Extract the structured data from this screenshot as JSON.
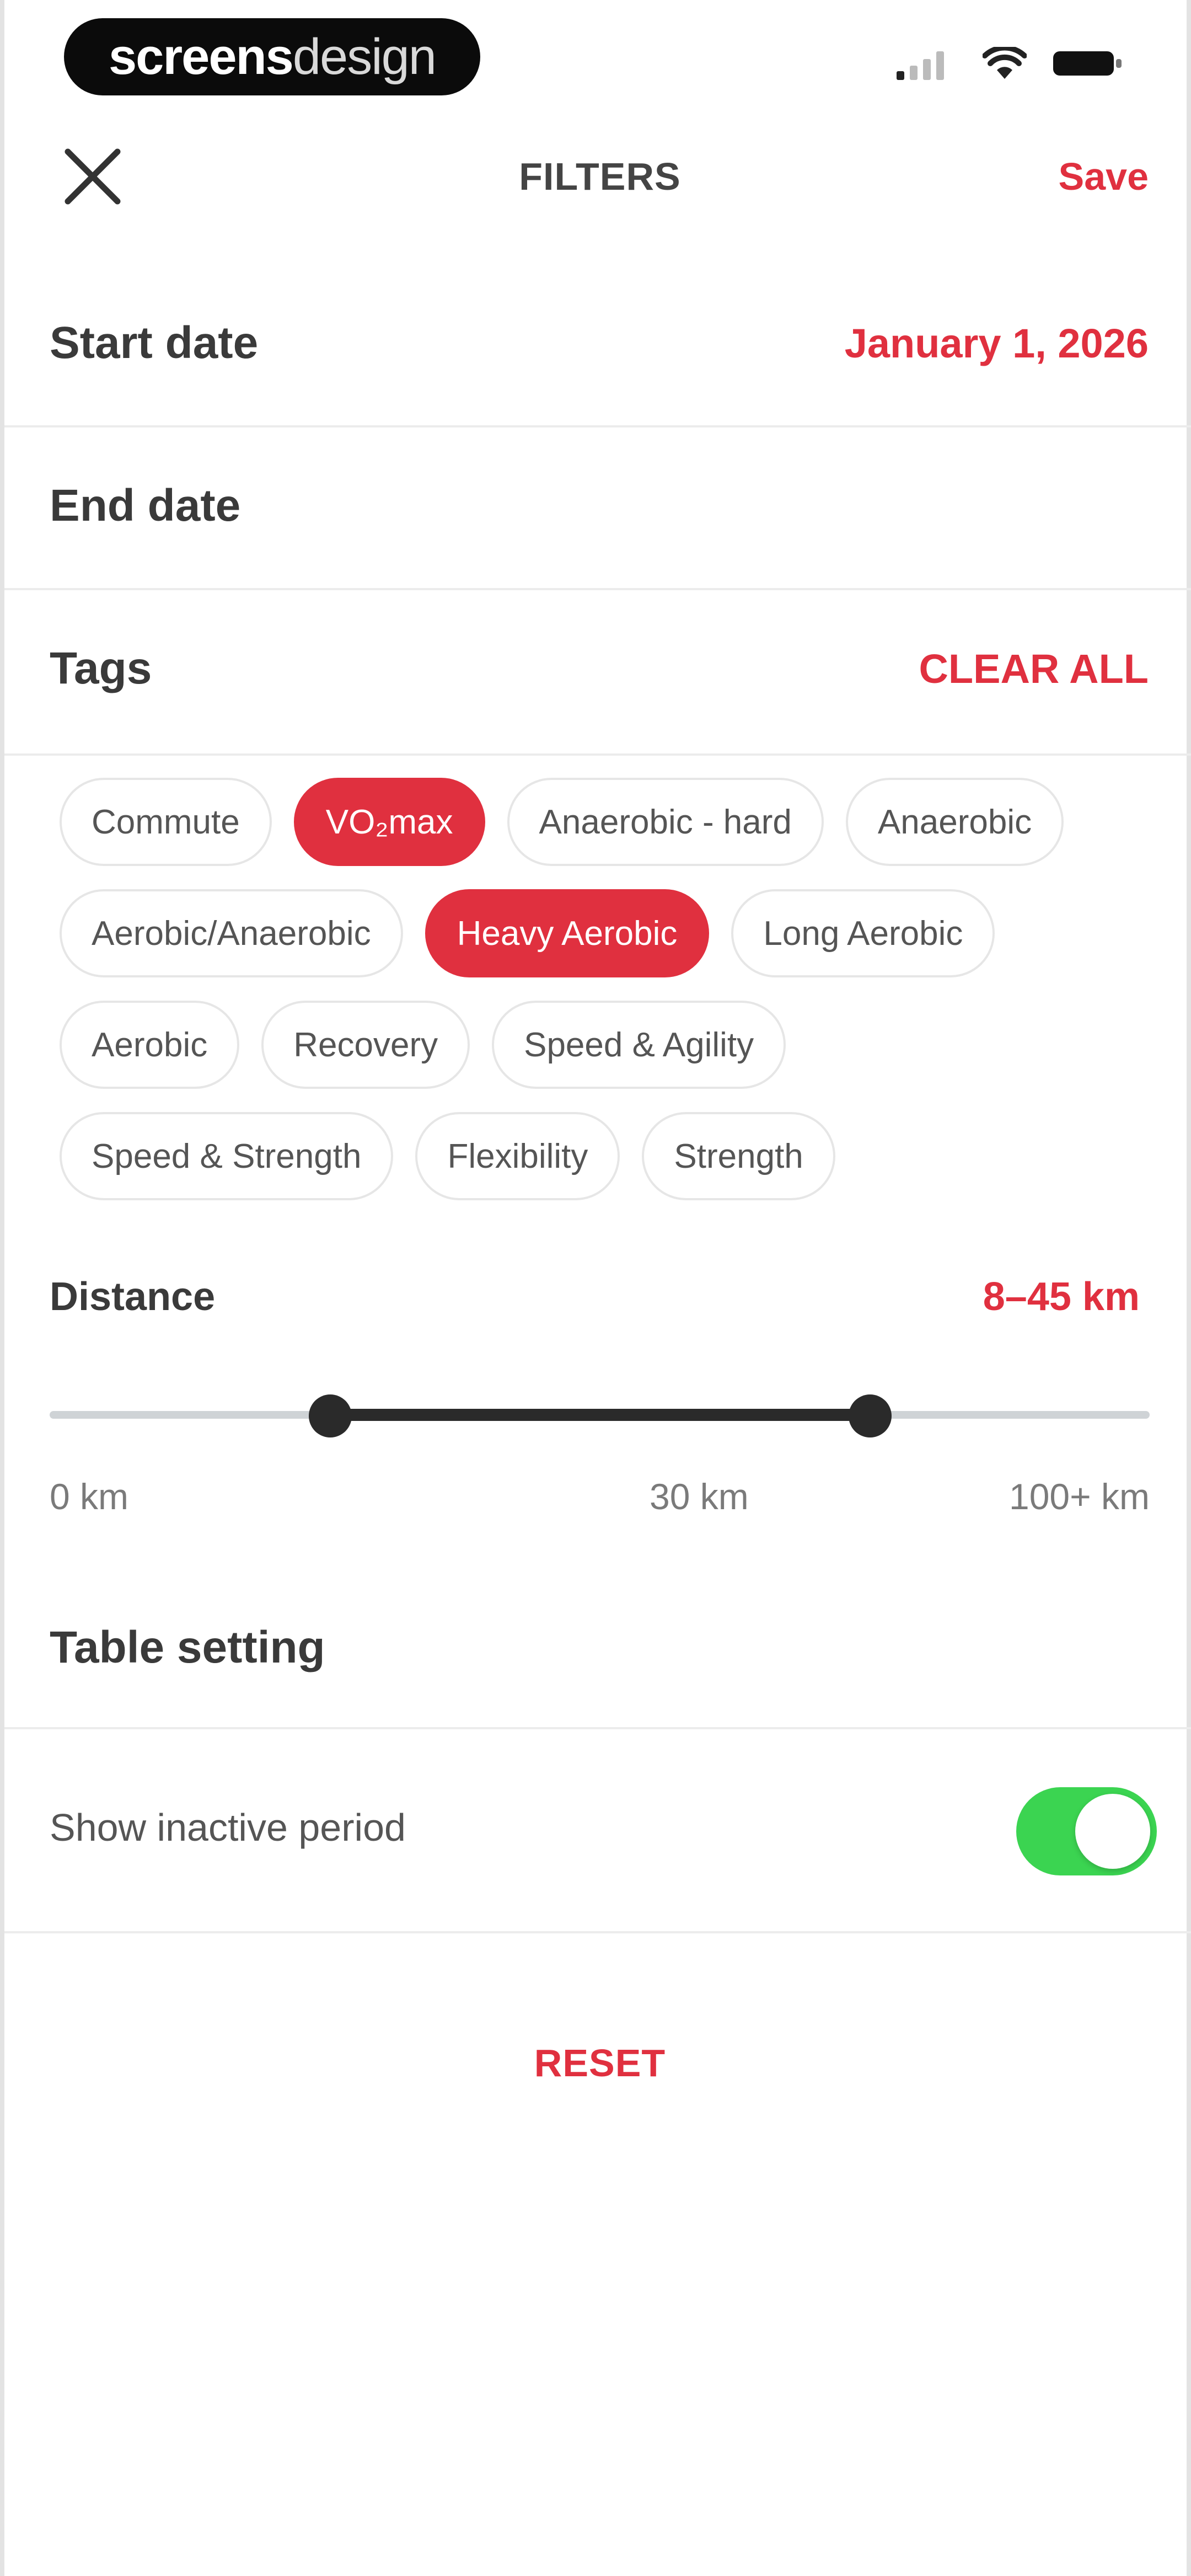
{
  "status_bar": {
    "brand_bold": "screens",
    "brand_light": "design",
    "icons": [
      "signal-icon",
      "wifi-icon",
      "battery-icon"
    ]
  },
  "nav": {
    "close_icon": "close-icon",
    "title": "FILTERS",
    "save_label": "Save"
  },
  "filters": {
    "start_date_label": "Start date",
    "start_date_value": "January 1, 2026",
    "end_date_label": "End date",
    "tags_label": "Tags",
    "clear_all_label": "CLEAR ALL"
  },
  "tags": [
    [
      {
        "label": "Commute",
        "selected": false
      },
      {
        "label": "VO₂max",
        "selected": true
      },
      {
        "label": "Anaerobic - hard",
        "selected": false
      },
      {
        "label": "Anaerobic",
        "selected": false
      }
    ],
    [
      {
        "label": "Aerobic/Anaerobic",
        "selected": false
      },
      {
        "label": "Heavy Aerobic",
        "selected": true
      },
      {
        "label": "Long Aerobic",
        "selected": false
      }
    ],
    [
      {
        "label": "Aerobic",
        "selected": false
      },
      {
        "label": "Recovery",
        "selected": false
      },
      {
        "label": "Speed & Agility",
        "selected": false
      }
    ],
    [
      {
        "label": "Speed & Strength",
        "selected": false
      },
      {
        "label": "Flexibility",
        "selected": false
      },
      {
        "label": "Strength",
        "selected": false
      }
    ]
  ],
  "distance": {
    "label": "Distance",
    "range_text": "8–45 km",
    "min_km": 0,
    "max_km": 100,
    "low_km": 8,
    "high_km": 45,
    "tick_labels": [
      "0 km",
      "30 km",
      "100+ km"
    ]
  },
  "table_setting": {
    "title": "Table setting",
    "show_inactive_label": "Show inactive period",
    "show_inactive_on": true
  },
  "reset_label": "RESET",
  "colors": {
    "accent": "#e0303f",
    "toggle_on": "#3bd451",
    "slider_fill": "#2a2a2a",
    "slider_track": "#cfd3d6"
  }
}
